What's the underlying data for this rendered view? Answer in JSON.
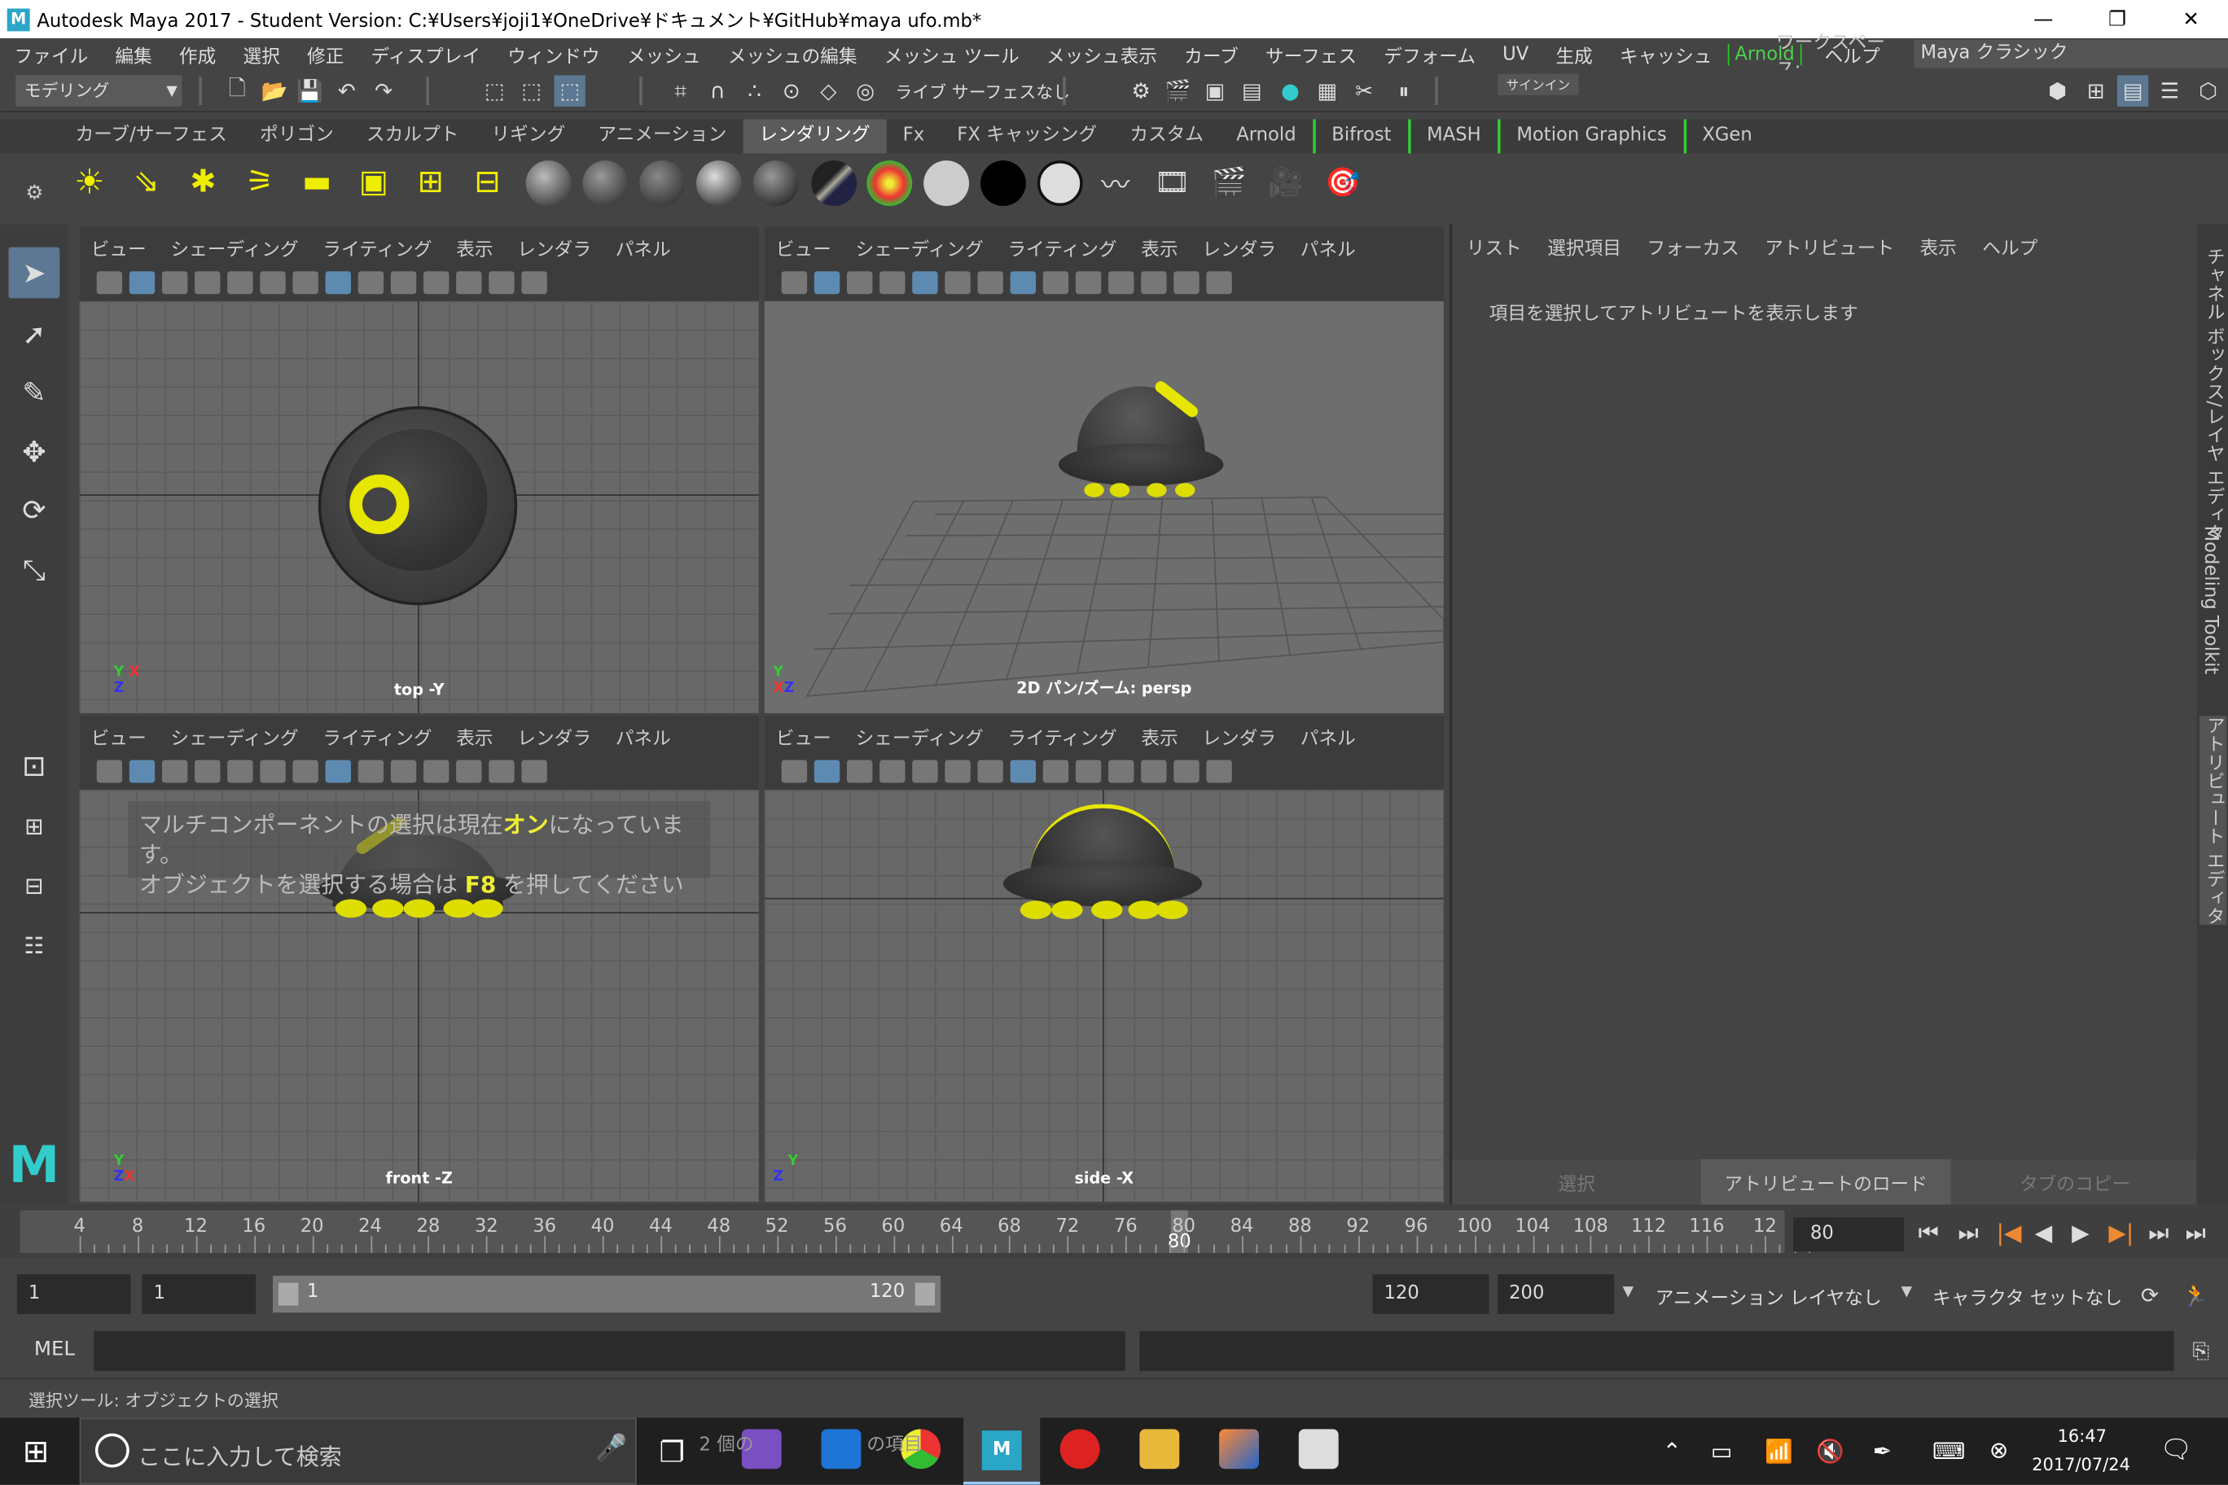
{
  "window": {
    "title": "Autodesk Maya 2017 - Student Version: C:¥Users¥joji1¥OneDrive¥ドキュメント¥GitHub¥maya ufo.mb*",
    "minimize": "—",
    "maximize": "❐",
    "close": "✕"
  },
  "menubar": {
    "items": [
      "ファイル",
      "編集",
      "作成",
      "選択",
      "修正",
      "ディスプレイ",
      "ウィンドウ",
      "メッシュ",
      "メッシュの編集",
      "メッシュ ツール",
      "メッシュ表示",
      "カーブ",
      "サーフェス",
      "デフォーム",
      "UV",
      "生成",
      "キャッシュ",
      "Arnold",
      "ヘルプ"
    ],
    "workspace_label": "ワークスペース:",
    "workspace_value": "Maya クラシック"
  },
  "statusline": {
    "mode": "モデリング",
    "live_surface": "ライブ サーフェスなし",
    "signin": "サインイン"
  },
  "shelf": {
    "tabs": [
      "カーブ/サーフェス",
      "ポリゴン",
      "スカルプト",
      "リギング",
      "アニメーション",
      "レンダリング",
      "Fx",
      "FX キャッシング",
      "カスタム",
      "Arnold",
      "Bifrost",
      "MASH",
      "Motion Graphics",
      "XGen"
    ],
    "active_tab": "レンダリング"
  },
  "viewports": [
    {
      "menu": [
        "ビュー",
        "シェーディング",
        "ライティング",
        "表示",
        "レンダラ",
        "パネル"
      ],
      "label": "top -Y"
    },
    {
      "menu": [
        "ビュー",
        "シェーディング",
        "ライティング",
        "表示",
        "レンダラ",
        "パネル"
      ],
      "label": "2D パン/ズーム: persp"
    },
    {
      "menu": [
        "ビュー",
        "シェーディング",
        "ライティング",
        "表示",
        "レンダラ",
        "パネル"
      ],
      "label": "front -Z"
    },
    {
      "menu": [
        "ビュー",
        "シェーディング",
        "ライティング",
        "表示",
        "レンダラ",
        "パネル"
      ],
      "label": "side -X"
    }
  ],
  "hud": {
    "line1_a": "マルチコンポーネントの選択は現在",
    "line1_on": "オン",
    "line1_b": "になっています。",
    "line2_a": "オブジェクトを選択する場合は ",
    "line2_key": "F8",
    "line2_b": " を押してください"
  },
  "attribute_panel": {
    "menu": [
      "リスト",
      "選択項目",
      "フォーカス",
      "アトリビュート",
      "表示",
      "ヘルプ"
    ],
    "info": "項目を選択してアトリビュートを表示します",
    "buttons": [
      "選択",
      "アトリビュートのロード",
      "タブのコピー"
    ]
  },
  "side_tabs": [
    "チャネル ボックス/レイヤ エディタ",
    "Modeling Toolkit",
    "アトリビュート エディタ"
  ],
  "timeline": {
    "ticks": [
      4,
      8,
      12,
      16,
      20,
      24,
      28,
      32,
      36,
      40,
      44,
      48,
      52,
      56,
      60,
      64,
      68,
      72,
      76,
      80,
      84,
      88,
      92,
      96,
      100,
      104,
      108,
      112,
      116,
      12
    ],
    "current_marker": "80",
    "current_frame": "80"
  },
  "range": {
    "start": "1",
    "playback_start": "1",
    "bar_start": "1",
    "bar_end": "120",
    "playback_end": "120",
    "end": "200",
    "anim_layer": "アニメーション レイヤなし",
    "char_set": "キャラクタ セットなし"
  },
  "command": {
    "lang": "MEL"
  },
  "help": {
    "text": "選択ツール: オブジェクトの選択"
  },
  "taskbar": {
    "search_placeholder": "ここに入力して検索",
    "overlay_text": "2 個の",
    "overlay_text2": "の項目",
    "time": "16:47",
    "date": "2017/07/24"
  },
  "colors": {
    "accent": "#5c7893",
    "yellow": "#e6e600",
    "arnold_green": "#4cd24c",
    "body": "#3a3a3a"
  }
}
